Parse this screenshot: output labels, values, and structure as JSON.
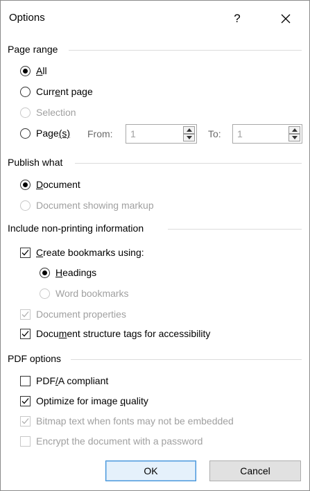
{
  "window": {
    "title": "Options",
    "help_label": "?"
  },
  "page_range": {
    "heading": "Page range",
    "all": {
      "pre": "",
      "u": "A",
      "post": "ll"
    },
    "current": {
      "pre": "Curr",
      "u": "e",
      "post": "nt page"
    },
    "selection": "Selection",
    "pages": {
      "pre": "Page",
      "u": "(s)",
      "post": ""
    },
    "from_label": "From:",
    "from_value": "1",
    "to_label": "To:",
    "to_value": "1"
  },
  "publish": {
    "heading": "Publish what",
    "document": {
      "pre": "",
      "u": "D",
      "post": "ocument"
    },
    "markup": "Document showing markup"
  },
  "nonprint": {
    "heading": "Include non-printing information",
    "bookmarks": {
      "pre": "",
      "u": "C",
      "post": "reate bookmarks using:"
    },
    "headings": {
      "pre": "",
      "u": "H",
      "post": "eadings"
    },
    "word_bookmarks": "Word bookmarks",
    "doc_props": "Document properties",
    "struct_tags": {
      "pre": "Docu",
      "u": "m",
      "post": "ent structure tags for accessibility"
    }
  },
  "pdf": {
    "heading": "PDF options",
    "pdfa": {
      "pre": "PDF",
      "u": "/",
      "post": "A compliant"
    },
    "optimize": {
      "pre": "Optimize for image ",
      "u": "q",
      "post": "uality"
    },
    "bitmap": "Bitmap text when fonts may not be embedded",
    "encrypt": "Encrypt the document with a password"
  },
  "buttons": {
    "ok": "OK",
    "cancel": "Cancel"
  }
}
